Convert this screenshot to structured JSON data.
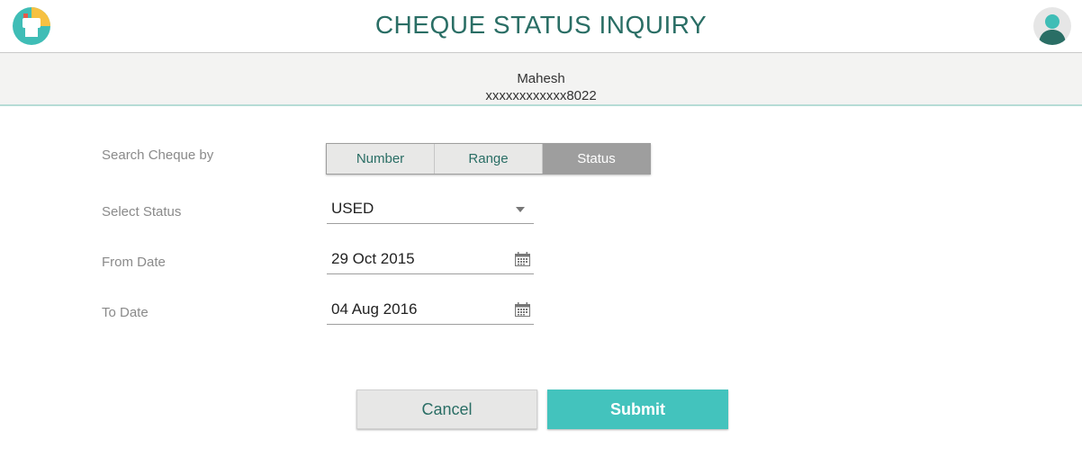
{
  "header": {
    "title": "CHEQUE STATUS INQUIRY"
  },
  "account": {
    "name": "Mahesh",
    "number": "xxxxxxxxxxxx8022"
  },
  "form": {
    "search_by_label": "Search Cheque by",
    "search_options": [
      "Number",
      "Range",
      "Status"
    ],
    "search_selected": "Status",
    "status_label": "Select Status",
    "status_value": "USED",
    "from_label": "From Date",
    "from_value": "29 Oct 2015",
    "to_label": "To Date",
    "to_value": "04 Aug 2016"
  },
  "actions": {
    "cancel_label": "Cancel",
    "submit_label": "Submit"
  },
  "icons": {
    "logo": "app-logo-icon",
    "avatar": "user-avatar-icon",
    "dropdown": "chevron-down-icon",
    "calendar": "calendar-icon"
  },
  "colors": {
    "primary_teal": "#2a6e65",
    "accent": "#43c3bd",
    "segment_active": "#9e9e9e"
  }
}
